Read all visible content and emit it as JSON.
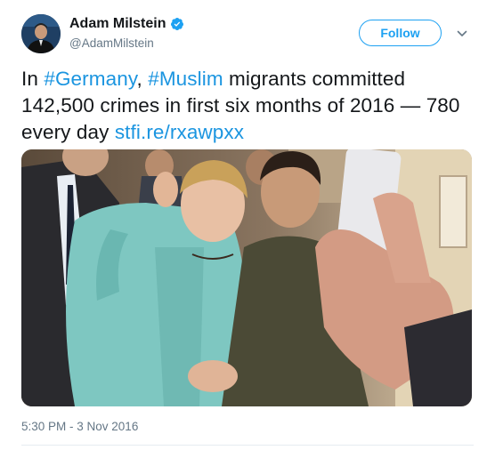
{
  "author": {
    "name": "Adam Milstein",
    "handle": "@AdamMilstein",
    "avatar_icon": "avatar-icon",
    "verified_icon": "verified-badge-icon"
  },
  "follow_label": "Follow",
  "menu_icon": "chevron-down-icon",
  "tweet": {
    "text_before": "In ",
    "hashtag_germany": "#Germany",
    "sep": ", ",
    "hashtag_muslim": "#Muslim",
    "text_after": " migrants committed 142,500 crimes in first six months of 2016 — 780 every day ",
    "link": "stfi.re/rxawpxx"
  },
  "timestamp": "5:30 PM - 3 Nov 2016",
  "colors": {
    "accent": "#1da1f2",
    "link": "#1b95e0",
    "secondary_text": "#657786"
  }
}
